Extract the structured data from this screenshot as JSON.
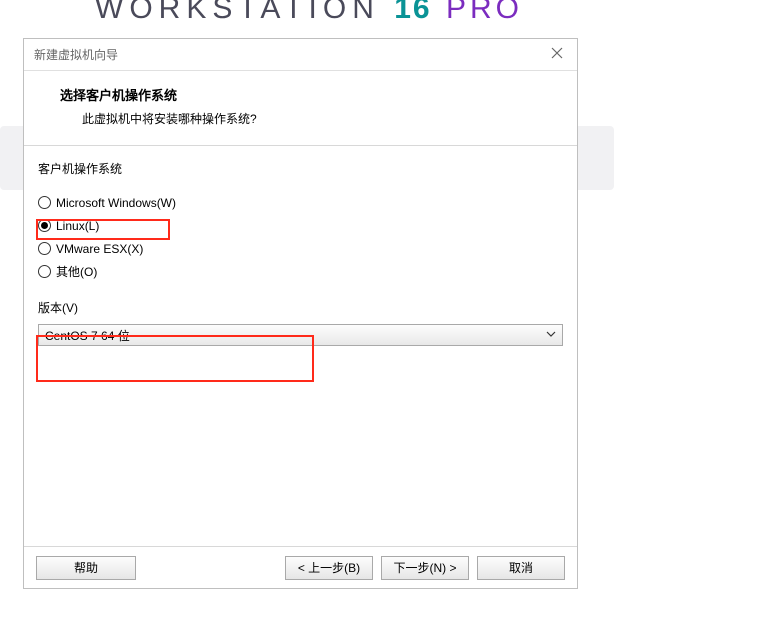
{
  "bg": {
    "logo_left": "WORKSTATION",
    "logo_num": "16",
    "logo_right": "PRO"
  },
  "dialog": {
    "title": "新建虚拟机向导",
    "header_title": "选择客户机操作系统",
    "header_sub": "此虚拟机中将安装哪种操作系统?"
  },
  "os_group_label": "客户机操作系统",
  "os_options": {
    "windows": "Microsoft Windows(W)",
    "linux": "Linux(L)",
    "esx": "VMware ESX(X)",
    "other": "其他(O)"
  },
  "version_label": "版本(V)",
  "version_value": "CentOS 7 64 位",
  "buttons": {
    "help": "帮助",
    "back": "< 上一步(B)",
    "next": "下一步(N) >",
    "cancel": "取消"
  }
}
